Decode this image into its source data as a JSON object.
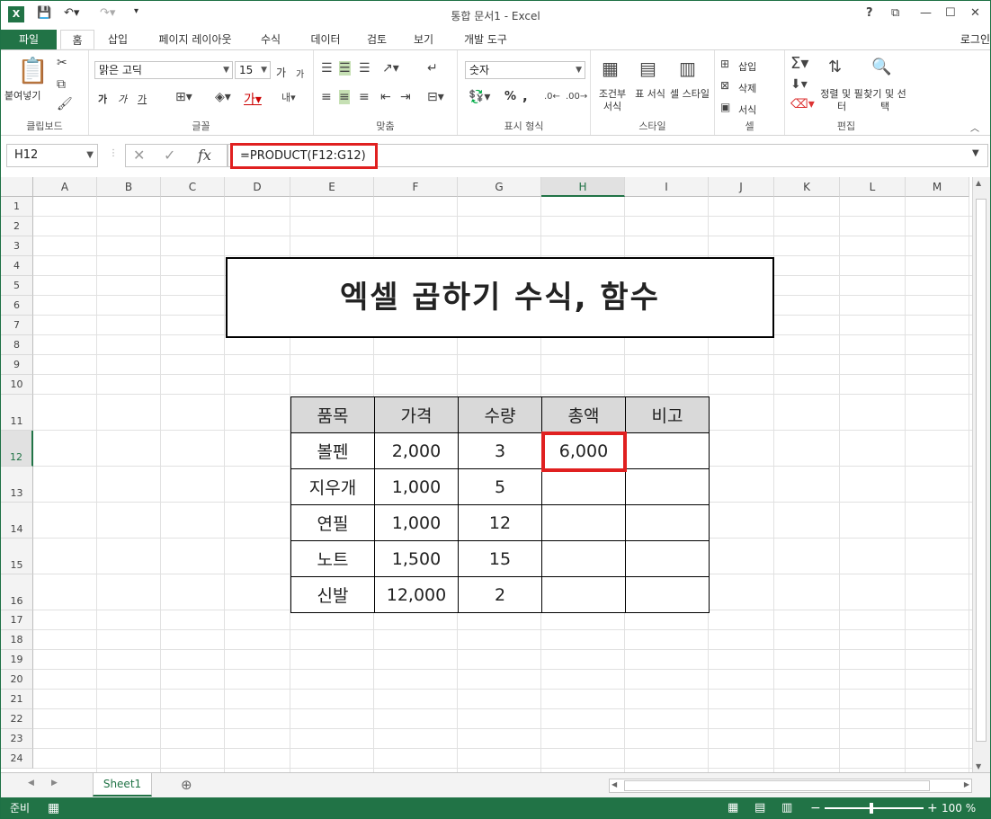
{
  "window": {
    "title": "통합 문서1 - Excel",
    "login": "로그인"
  },
  "tabs": [
    "파일",
    "홈",
    "삽입",
    "페이지 레이아웃",
    "수식",
    "데이터",
    "검토",
    "보기",
    "개발 도구"
  ],
  "ribbon": {
    "clipboard": {
      "paste": "붙여넣기",
      "label": "클립보드"
    },
    "font": {
      "name": "맑은 고딕",
      "size": "15",
      "label": "글꼴",
      "bold": "가",
      "italic": "가",
      "underline": "가",
      "grow": "가",
      "shrink": "가"
    },
    "align": {
      "label": "맞춤"
    },
    "number": {
      "format": "숫자",
      "label": "표시 형식",
      "percent": "%",
      "comma": ","
    },
    "styles": {
      "cond": "조건부 서식",
      "table": "표 서식",
      "cell": "셀 스타일",
      "label": "스타일"
    },
    "cells": {
      "insert": "삽입",
      "delete": "삭제",
      "format": "서식",
      "label": "셀"
    },
    "edit": {
      "sort": "정렬 및 필터",
      "find": "찾기 및 선택",
      "label": "편집"
    }
  },
  "formula_bar": {
    "name_box": "H12",
    "formula": "=PRODUCT(F12:G12)"
  },
  "columns": [
    "A",
    "B",
    "C",
    "D",
    "E",
    "F",
    "G",
    "H",
    "I",
    "J",
    "K",
    "L",
    "M"
  ],
  "rows": [
    "1",
    "2",
    "3",
    "4",
    "5",
    "6",
    "7",
    "8",
    "9",
    "10",
    "11",
    "12",
    "13",
    "14",
    "15",
    "16",
    "17",
    "18",
    "19",
    "20",
    "21",
    "22",
    "23",
    "24"
  ],
  "sheet_title": "엑셀 곱하기 수식, 함수",
  "table": {
    "headers": [
      "품목",
      "가격",
      "수량",
      "총액",
      "비고"
    ],
    "rows": [
      [
        "볼펜",
        "2,000",
        "3",
        "6,000",
        ""
      ],
      [
        "지우개",
        "1,000",
        "5",
        "",
        ""
      ],
      [
        "연필",
        "1,000",
        "12",
        "",
        ""
      ],
      [
        "노트",
        "1,500",
        "15",
        "",
        ""
      ],
      [
        "신발",
        "12,000",
        "2",
        "",
        ""
      ]
    ]
  },
  "sheet_tab": "Sheet1",
  "status": {
    "ready": "준비",
    "zoom": "100 %"
  }
}
